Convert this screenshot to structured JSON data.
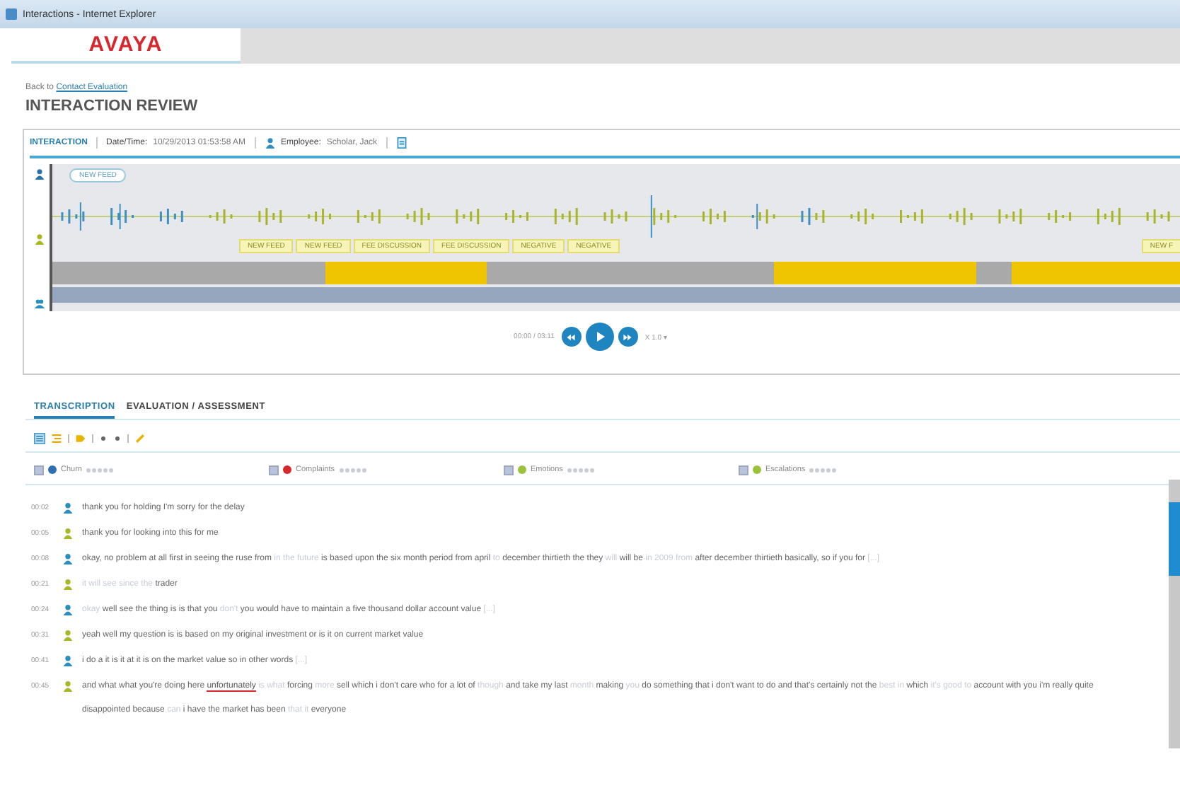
{
  "window": {
    "title": "Interactions - Internet Explorer"
  },
  "header": {
    "logo": "AVAYA"
  },
  "back_link": {
    "prefix": "Back to",
    "link": "Contact Evaluation"
  },
  "page_title": "INTERACTION REVIEW",
  "interaction": {
    "tab": "INTERACTION",
    "date_label": "Date/Time:",
    "date": "10/29/2013 01:53:58 AM",
    "employee_label": "Employee:",
    "employee": "Scholar, Jack",
    "bubble": "NEW FEED",
    "tags": [
      {
        "label": "NEW FEED"
      },
      {
        "label": "NEW FEED"
      },
      {
        "label": "FEE DISCUSSION"
      },
      {
        "label": "FEE DISCUSSION"
      },
      {
        "label": "NEGATIVE"
      },
      {
        "label": "NEGATIVE"
      }
    ],
    "edge_tag": "NEW F",
    "player": {
      "time": "00:00 / 03:11",
      "speed": "X 1.0",
      "caret": "▾"
    }
  },
  "tabs": [
    {
      "label": "TRANSCRIPTION",
      "selected": true
    },
    {
      "label": "EVALUATION / ASSESSMENT",
      "selected": false
    }
  ],
  "filters": [
    {
      "label": "Churn",
      "color": "#2e6fb0",
      "checked": true,
      "stars": 0
    },
    {
      "label": "Complaints",
      "color": "#d8262c",
      "checked": true,
      "stars": 0
    },
    {
      "label": "Emotions",
      "color": "#9ac23c",
      "checked": true,
      "stars": 0
    },
    {
      "label": "Escalations",
      "color": "#9ac23c",
      "checked": true,
      "stars": 0
    }
  ],
  "transcript": [
    {
      "time": "00:02",
      "kind": "agent",
      "segments": [
        {
          "kind": "plain",
          "text": "thank you for holding I'm sorry for the delay"
        }
      ]
    },
    {
      "time": "00:05",
      "kind": "customer",
      "segments": [
        {
          "kind": "plain",
          "text": "thank you for looking into this for me"
        }
      ]
    },
    {
      "time": "00:08",
      "kind": "agent",
      "segments": [
        {
          "kind": "plain",
          "text": "okay, no problem at all first in seeing the ruse from"
        },
        {
          "kind": "faint",
          "text": "in the future"
        },
        {
          "kind": "plain",
          "text": "is based upon the six month period from april"
        },
        {
          "kind": "faint",
          "text": "to"
        },
        {
          "kind": "plain",
          "text": "december thirtieth the they"
        },
        {
          "kind": "faint",
          "text": "will"
        },
        {
          "kind": "plain",
          "text": "will be"
        },
        {
          "kind": "faint",
          "text": "in 2009 from"
        },
        {
          "kind": "plain",
          "text": "after december thirtieth basically, so if you for"
        },
        {
          "kind": "faint",
          "text": "[...]"
        }
      ]
    },
    {
      "time": "00:21",
      "kind": "customer",
      "segments": [
        {
          "kind": "faint",
          "text": "it will see since the"
        },
        {
          "kind": "plain",
          "text": "trader"
        }
      ]
    },
    {
      "time": "00:24",
      "kind": "agent",
      "segments": [
        {
          "kind": "faint",
          "text": "okay"
        },
        {
          "kind": "plain",
          "text": "well see the thing is is that you"
        },
        {
          "kind": "faint",
          "text": "don't"
        },
        {
          "kind": "plain",
          "text": "you would have to maintain a five thousand dollar account value"
        },
        {
          "kind": "faint",
          "text": "[...]"
        }
      ]
    },
    {
      "time": "00:31",
      "kind": "customer",
      "segments": [
        {
          "kind": "plain",
          "text": "yeah well my question is is based on my original investment or is it on current market value"
        }
      ]
    },
    {
      "time": "00:41",
      "kind": "agent",
      "segments": [
        {
          "kind": "plain",
          "text": "i do a it is it at it is on the market value so in other words"
        },
        {
          "kind": "faint",
          "text": "[...]"
        }
      ]
    },
    {
      "time": "00:45",
      "kind": "customer",
      "segments": [
        {
          "kind": "plain",
          "text": "and what what you're doing here"
        },
        {
          "kind": "flagged",
          "text": "unfortunately"
        },
        {
          "kind": "faint",
          "text": "is what"
        },
        {
          "kind": "plain",
          "text": "forcing"
        },
        {
          "kind": "faint",
          "text": "more"
        },
        {
          "kind": "plain",
          "text": "sell which i don't care who for a lot of"
        },
        {
          "kind": "faint",
          "text": "though"
        },
        {
          "kind": "plain",
          "text": "and take my last"
        },
        {
          "kind": "faint",
          "text": "month"
        },
        {
          "kind": "plain",
          "text": "making"
        },
        {
          "kind": "faint",
          "text": "you"
        },
        {
          "kind": "plain",
          "text": "do something that i don't want to do and that's certainly not the"
        },
        {
          "kind": "faint",
          "text": "best in"
        },
        {
          "kind": "plain",
          "text": "which"
        },
        {
          "kind": "faint",
          "text": "it's good to"
        },
        {
          "kind": "plain",
          "text": "account with you i'm really quite disappointed because"
        },
        {
          "kind": "faint",
          "text": "can"
        },
        {
          "kind": "plain",
          "text": "i have the market has been"
        },
        {
          "kind": "faint",
          "text": "that it"
        },
        {
          "kind": "plain",
          "text": "everyone"
        }
      ]
    }
  ]
}
